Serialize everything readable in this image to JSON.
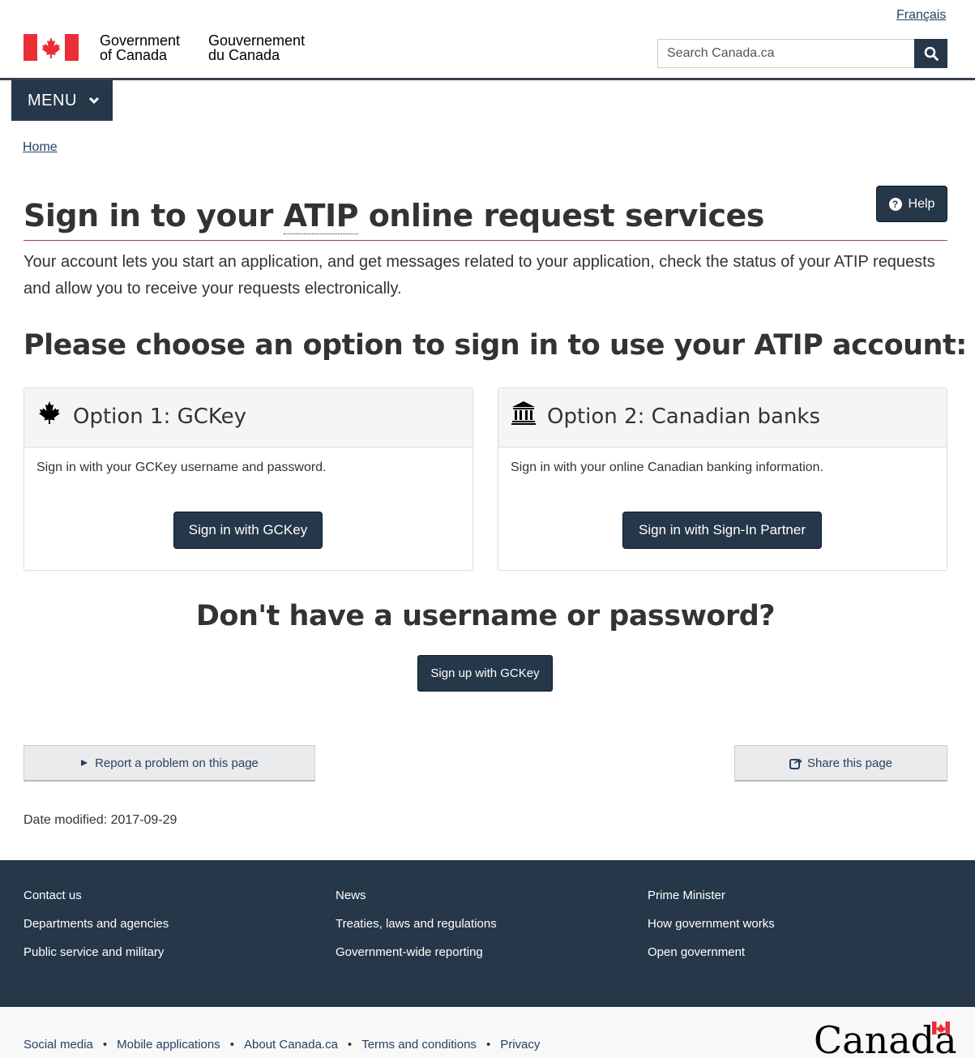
{
  "header": {
    "language_link": "Français",
    "gov_en_line1": "Government",
    "gov_en_line2": "of Canada",
    "gov_fr_line1": "Gouvernement",
    "gov_fr_line2": "du Canada",
    "search_placeholder": "Search Canada.ca",
    "menu_label": "MENU"
  },
  "breadcrumb": {
    "home": "Home"
  },
  "main": {
    "help_label": "Help",
    "title_prefix": "Sign in to your ",
    "title_abbr": "ATIP",
    "title_suffix": " online request services",
    "intro": "Your account lets you start an application, and get messages related to your application, check the status of your ATIP requests and allow you to receive your requests electronically.",
    "choose_heading": "Please choose an option to sign in to use your ATIP account:",
    "options": [
      {
        "icon": "maple-leaf-icon",
        "title": "Option 1: GCKey",
        "description": "Sign in with your GCKey username and password.",
        "button": "Sign in with GCKey"
      },
      {
        "icon": "bank-icon",
        "title": "Option 2: Canadian banks",
        "description": "Sign in with your online Canadian banking information.",
        "button": "Sign in with Sign-In Partner"
      }
    ],
    "no_account_heading": "Don't have a username or password?",
    "signup_button": "Sign up with GCKey",
    "report_problem": "Report a problem on this page",
    "share_page": "Share this page",
    "date_modified": "Date modified: 2017-09-29"
  },
  "footer": {
    "columns": [
      [
        "Contact us",
        "Departments and agencies",
        "Public service and military"
      ],
      [
        "News",
        "Treaties, laws and regulations",
        "Government-wide reporting"
      ],
      [
        "Prime Minister",
        "How government works",
        "Open government"
      ]
    ],
    "sub_links": [
      "Social media",
      "Mobile applications",
      "About Canada.ca",
      "Terms and conditions",
      "Privacy"
    ],
    "wordmark": "Canada"
  },
  "colors": {
    "primary_dark": "#26374a",
    "link": "#284162",
    "flag_red": "#eb2d37",
    "title_rule": "#af3c43"
  }
}
